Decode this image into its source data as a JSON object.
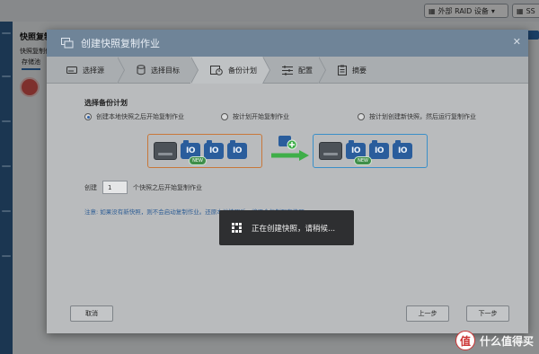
{
  "background": {
    "external_raid_label": "外部 RAID 设备",
    "topbar_extra": "SS",
    "title": "快照复制",
    "subtitle": "快照复制作业",
    "tab_label": "存储池"
  },
  "dialog": {
    "title": "创建快照复制作业",
    "close_symbol": "✕",
    "steps": [
      {
        "label": "选择源"
      },
      {
        "label": "选择目标"
      },
      {
        "label": "备份计划"
      },
      {
        "label": "配置"
      },
      {
        "label": "摘要"
      }
    ],
    "section_title": "选择备份计划",
    "options": [
      {
        "label": "创建本地快照之后开始复制作业",
        "selected": true
      },
      {
        "label": "按计划开始复制作业",
        "selected": false
      },
      {
        "label": "按计划创建新快照，然后运行复制作业",
        "selected": false
      }
    ],
    "diagram": {
      "snap_text": "IO",
      "new_badge": "NEW"
    },
    "create_prefix": "创建",
    "create_count": "1",
    "create_suffix": "个快照之后开始复制作业",
    "note": "注意: 如果没有新快照，则不会启动复制作业。还原本地快照后，将不会复制现有快照。",
    "toast": "正在创建快照，请稍候...",
    "buttons": {
      "cancel": "取消",
      "prev": "上一步",
      "next": "下一步"
    }
  },
  "watermark": {
    "logo_char": "值",
    "text": "什么值得买"
  },
  "colors": {
    "accent_blue": "#2a5d9c",
    "orange_box": "#c8783a",
    "blue_box": "#3a8fc8",
    "arrow_green": "#3fae49",
    "note_blue": "#2f5e95"
  }
}
